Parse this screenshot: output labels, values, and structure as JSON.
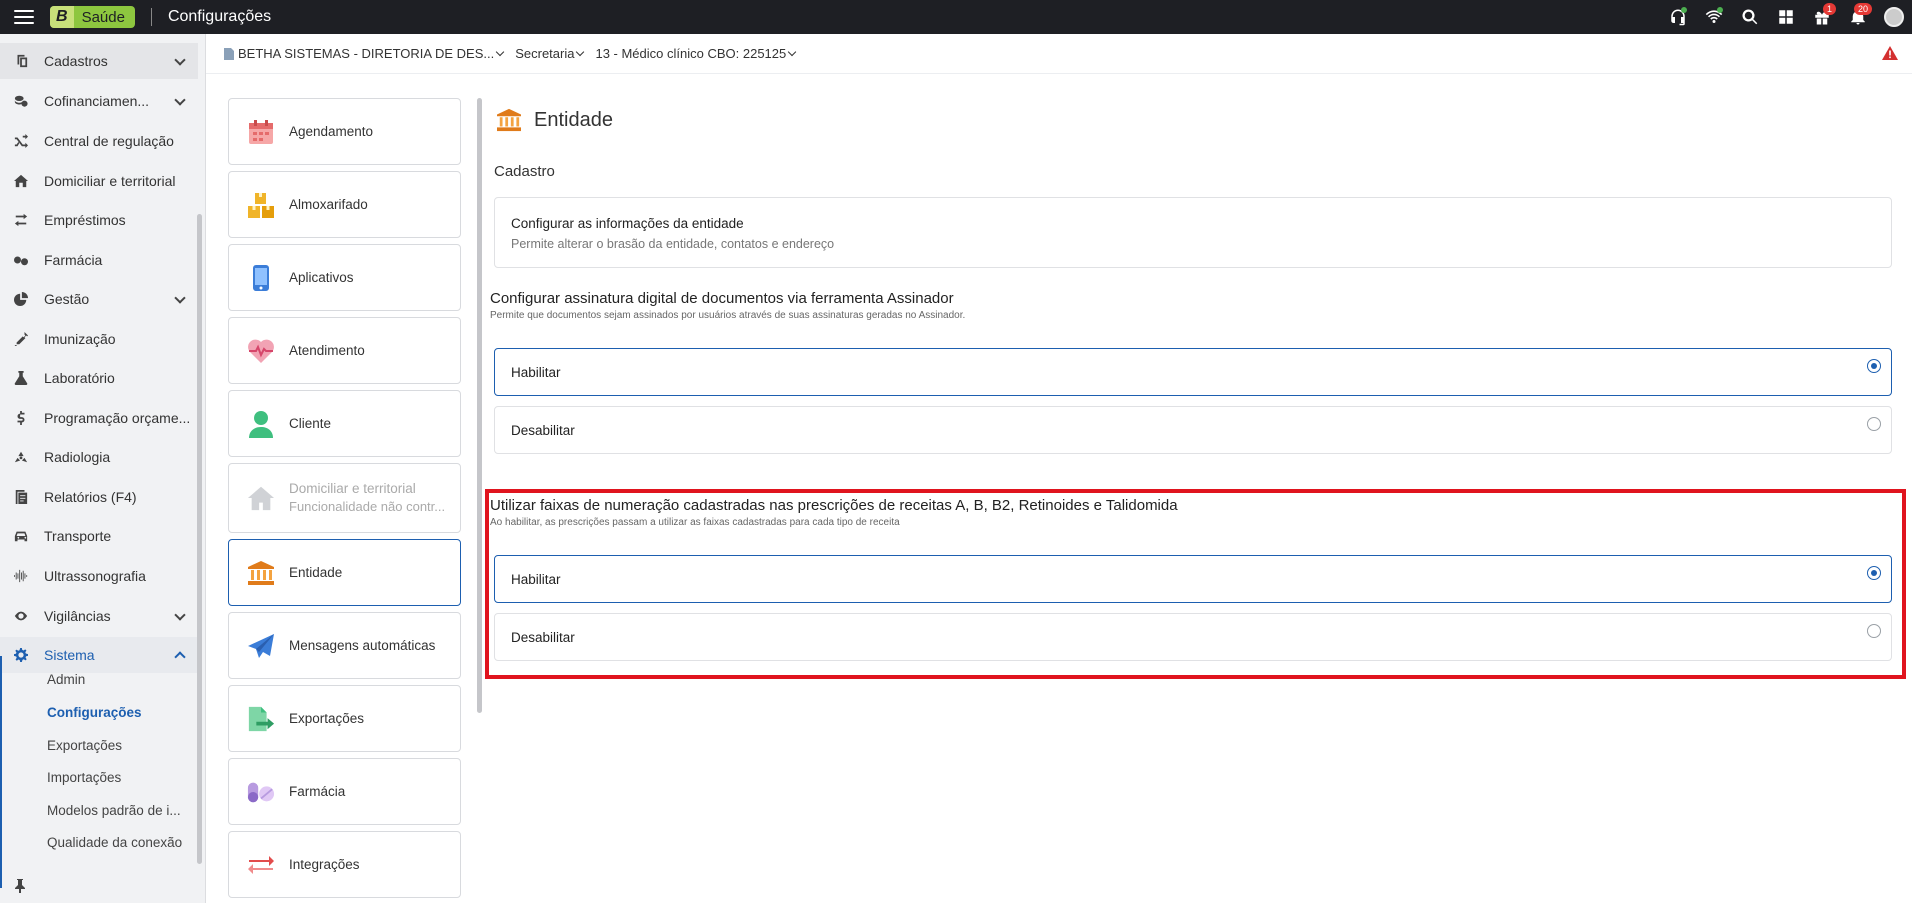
{
  "topbar": {
    "brand_letter": "B",
    "brand_name": "Saúde",
    "page_title": "Configurações",
    "notifications_badge": "1",
    "alerts_badge": "20",
    "icons": [
      "headset-icon",
      "wifi-icon",
      "search-icon",
      "apps-grid-icon",
      "gift-icon",
      "bell-icon",
      "user-avatar"
    ]
  },
  "sidebar": {
    "items": [
      {
        "label": "Cadastros",
        "icon": "copy-icon",
        "expandable": true
      },
      {
        "label": "Cofinanciamen...",
        "icon": "coins-icon",
        "expandable": true
      },
      {
        "label": "Central de regulação",
        "icon": "shuffle-icon",
        "expandable": false
      },
      {
        "label": "Domiciliar e territorial",
        "icon": "home-icon",
        "expandable": false
      },
      {
        "label": "Empréstimos",
        "icon": "exchange-icon",
        "expandable": false
      },
      {
        "label": "Farmácia",
        "icon": "pills-icon",
        "expandable": false
      },
      {
        "label": "Gestão",
        "icon": "pie-chart-icon",
        "expandable": true
      },
      {
        "label": "Imunização",
        "icon": "syringe-icon",
        "expandable": false
      },
      {
        "label": "Laboratório",
        "icon": "flask-icon",
        "expandable": false
      },
      {
        "label": "Programação orçame...",
        "icon": "dollar-icon",
        "expandable": false
      },
      {
        "label": "Radiologia",
        "icon": "radiation-icon",
        "expandable": false
      },
      {
        "label": "Relatórios (F4)",
        "icon": "report-icon",
        "expandable": false
      },
      {
        "label": "Transporte",
        "icon": "car-icon",
        "expandable": false
      },
      {
        "label": "Ultrassonografia",
        "icon": "waveform-icon",
        "expandable": false
      },
      {
        "label": "Vigilâncias",
        "icon": "eye-icon",
        "expandable": true
      },
      {
        "label": "Sistema",
        "icon": "gear-icon",
        "expandable": true,
        "active": true
      }
    ],
    "sub_items": [
      {
        "label": "Admin"
      },
      {
        "label": "Configurações",
        "active": true
      },
      {
        "label": "Exportações"
      },
      {
        "label": "Importações"
      },
      {
        "label": "Modelos padrão de i..."
      },
      {
        "label": "Qualidade da conexão"
      }
    ]
  },
  "breadcrumb": {
    "entity": "BETHA SISTEMAS - DIRETORIA DE DES...",
    "unit": "Secretaria",
    "profile": "13 - Médico clínico CBO: 225125"
  },
  "categories": [
    {
      "label": "Agendamento",
      "icon": "calendar-icon"
    },
    {
      "label": "Almoxarifado",
      "icon": "boxes-icon"
    },
    {
      "label": "Aplicativos",
      "icon": "phone-icon"
    },
    {
      "label": "Atendimento",
      "icon": "heartbeat-icon"
    },
    {
      "label": "Cliente",
      "icon": "person-icon"
    },
    {
      "label": "Domiciliar e territorial",
      "sub": "Funcionalidade não contr...",
      "icon": "house-icon",
      "disabled": true
    },
    {
      "label": "Entidade",
      "icon": "bank-icon",
      "selected": true
    },
    {
      "label": "Mensagens automáticas",
      "icon": "paper-plane-icon"
    },
    {
      "label": "Exportações",
      "icon": "file-export-icon"
    },
    {
      "label": "Farmácia",
      "icon": "pills-icon"
    },
    {
      "label": "Integrações",
      "icon": "arrows-icon"
    }
  ],
  "main": {
    "title": "Entidade",
    "section": "Cadastro",
    "card_title": "Configurar as informações da entidade",
    "card_desc": "Permite alterar o brasão da entidade, contatos e endereço",
    "group1": {
      "title": "Configurar assinatura digital de documentos via ferramenta Assinador",
      "desc": "Permite que documentos sejam assinados por usuários através de suas assinaturas geradas no Assinador.",
      "options": [
        {
          "label": "Habilitar",
          "checked": true
        },
        {
          "label": "Desabilitar",
          "checked": false
        }
      ]
    },
    "group2": {
      "title": "Utilizar faixas de numeração cadastradas nas prescrições de receitas A, B, B2, Retinoides e Talidomida",
      "desc": "Ao habilitar, as prescrições passam a utilizar as faixas cadastradas para cada tipo de receita",
      "options": [
        {
          "label": "Habilitar",
          "checked": true
        },
        {
          "label": "Desabilitar",
          "checked": false
        }
      ]
    }
  },
  "colors": {
    "accent": "#1d5fb0",
    "highlight": "#e0141e",
    "topbar": "#1e1f24"
  }
}
